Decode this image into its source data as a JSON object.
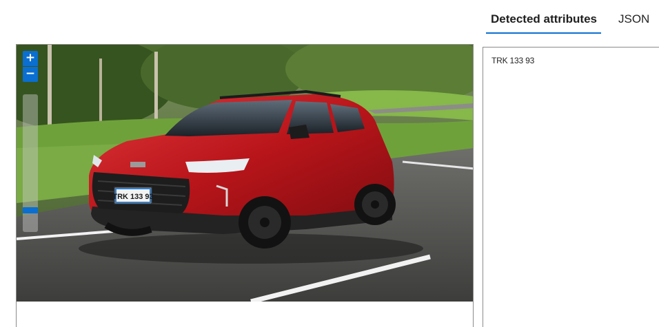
{
  "zoom": {
    "in_label": "+",
    "out_label": "−",
    "level": 0.1
  },
  "tabs": [
    {
      "label": "Detected attributes",
      "active": true
    },
    {
      "label": "JSON",
      "active": false
    }
  ],
  "plate_text": "TRK 133 93",
  "results": {
    "detected_text": "TRK 133 93"
  },
  "colors": {
    "accent": "#0a6fd1",
    "car_body": "#c0161b"
  }
}
